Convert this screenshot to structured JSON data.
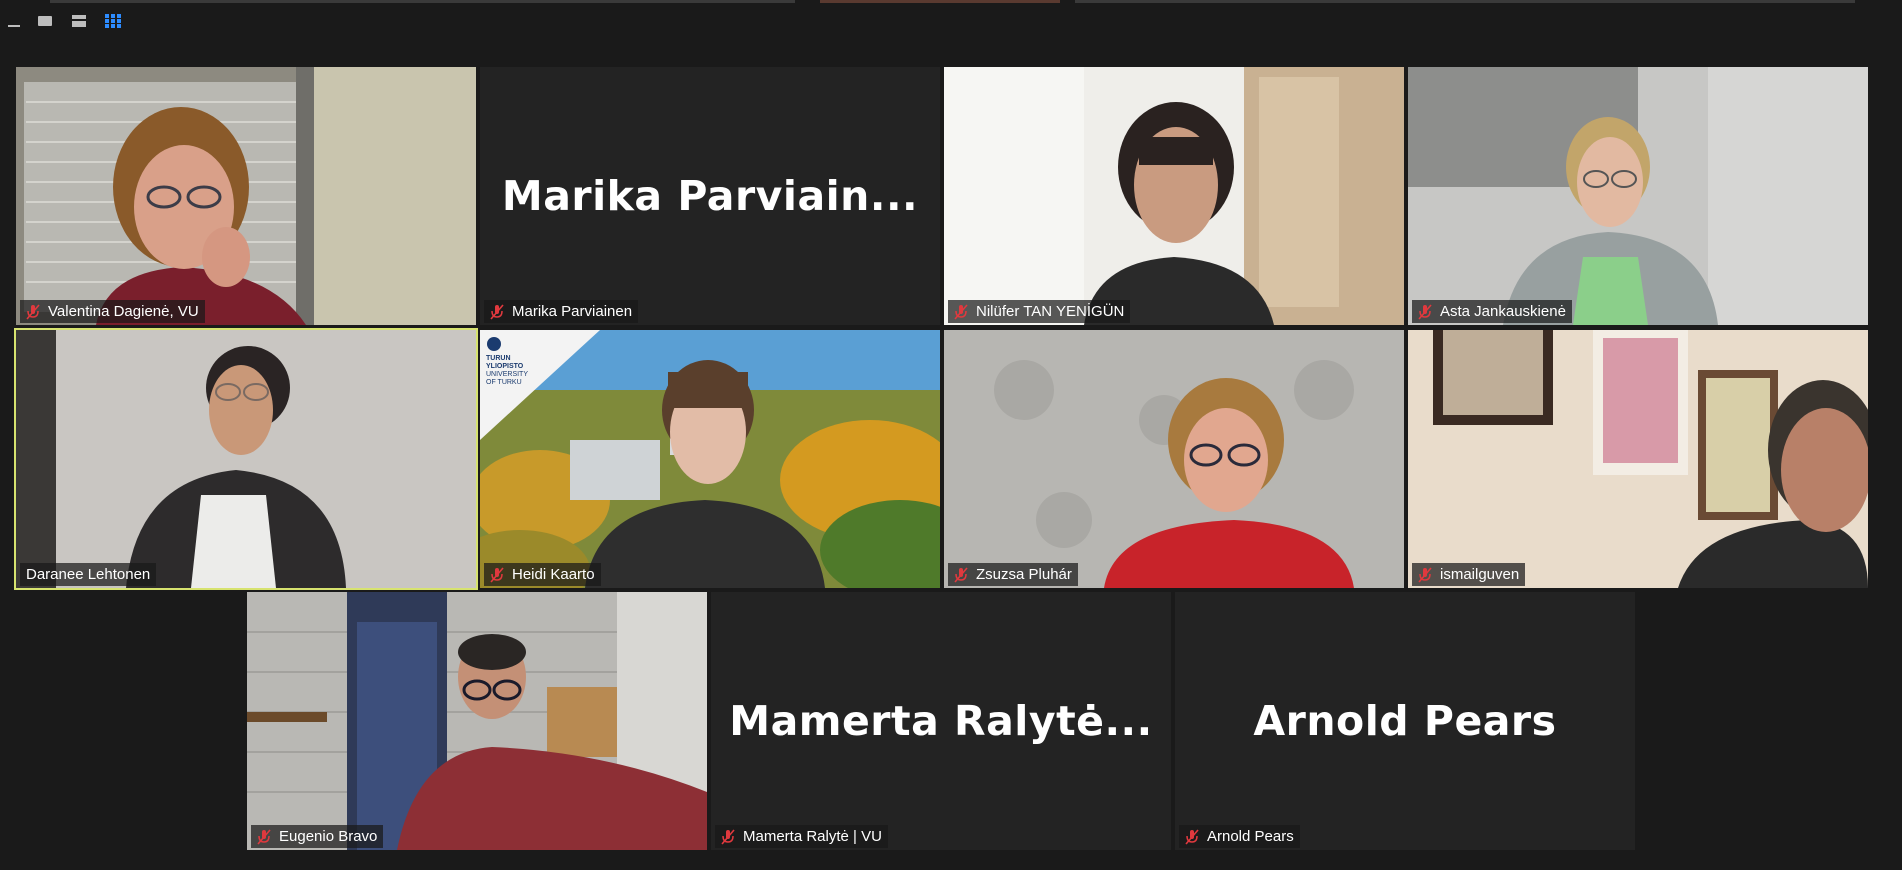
{
  "toolbar": {
    "view_buttons": [
      {
        "name": "minimize-icon"
      },
      {
        "name": "speaker-view-icon"
      },
      {
        "name": "strip-view-icon"
      },
      {
        "name": "gallery-view-icon",
        "active": true,
        "color": "#2d8cff"
      }
    ]
  },
  "participants": [
    {
      "id": "valentina",
      "label": "Valentina Dagienė, VU",
      "muted": true,
      "video": true
    },
    {
      "id": "marika",
      "label": "Marika Parviainen",
      "display_name": "Marika  Parviain...",
      "muted": true,
      "video": false
    },
    {
      "id": "nilufer",
      "label": "Nilüfer TAN YENİGÜN",
      "muted": true,
      "video": true
    },
    {
      "id": "asta",
      "label": "Asta Jankauskienė",
      "muted": true,
      "video": true
    },
    {
      "id": "daranee",
      "label": "Daranee Lehtonen",
      "muted": false,
      "video": true,
      "active_speaker": true
    },
    {
      "id": "heidi",
      "label": "Heidi Kaarto",
      "muted": true,
      "video": true,
      "background_logo": "TURUN YLIOPISTO UNIVERSITY OF TURKU"
    },
    {
      "id": "zsuzsa",
      "label": "Zsuzsa Pluhár",
      "muted": true,
      "video": true
    },
    {
      "id": "ismail",
      "label": "ismailguven",
      "muted": true,
      "video": true
    },
    {
      "id": "eugenio",
      "label": "Eugenio Bravo",
      "muted": true,
      "video": true
    },
    {
      "id": "mamerta",
      "label": "Mamerta Ralytė | VU",
      "display_name": "Mamerta  Ralytė...",
      "muted": true,
      "video": false
    },
    {
      "id": "arnold",
      "label": "Arnold Pears",
      "display_name": "Arnold Pears",
      "muted": true,
      "video": false
    }
  ],
  "colors": {
    "background": "#1a1a1a",
    "tile_background": "#232323",
    "active_speaker_border": "#d7e36f",
    "muted_icon": "#e0393e",
    "accent": "#2d8cff"
  }
}
